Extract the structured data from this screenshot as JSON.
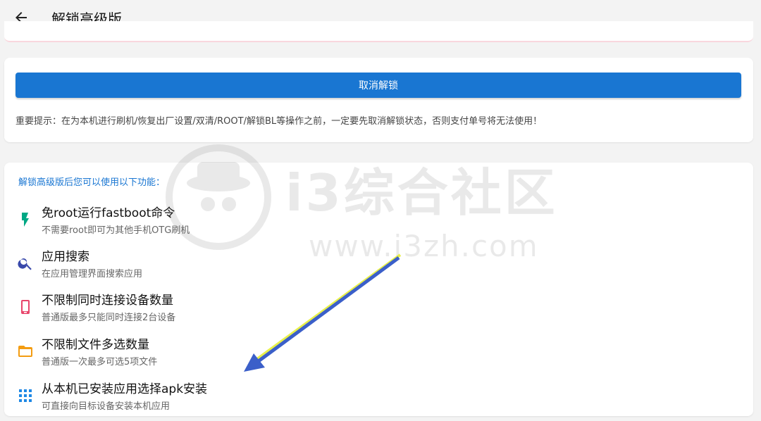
{
  "header": {
    "title": "解锁高级版",
    "back_icon": "arrow-left-icon"
  },
  "unlock_card": {
    "button_label": "取消解锁",
    "warning": "重要提示：在为本机进行刷机/恢复出厂设置/双清/ROOT/解锁BL等操作之前，一定要先取消解锁状态，否则支付单号将无法使用！"
  },
  "features": {
    "heading": "解锁高级版后您可以使用以下功能：",
    "items": [
      {
        "title": "免root运行fastboot命令",
        "subtitle": "不需要root即可为其他手机OTG刷机",
        "icon": "lightning-bolt-icon",
        "color": "#00a884"
      },
      {
        "title": "应用搜索",
        "subtitle": "在应用管理界面搜索应用",
        "icon": "search-icon",
        "color": "#3949ab"
      },
      {
        "title": "不限制同时连接设备数量",
        "subtitle": "普通版最多只能同时连接2台设备",
        "icon": "smartphone-icon",
        "color": "#e8456b"
      },
      {
        "title": "不限制文件多选数量",
        "subtitle": "普通版一次最多可选5项文件",
        "icon": "folder-icon",
        "color": "#f39c12"
      },
      {
        "title": "从本机已安装应用选择apk安装",
        "subtitle": "可直接向目标设备安装本机应用",
        "icon": "apps-grid-icon",
        "color": "#1e88e5"
      }
    ]
  },
  "watermark": {
    "text": "i3综合社区",
    "url": "www.i3zh.com"
  },
  "colors": {
    "primary": "#1976d2",
    "background": "#f3f3f3",
    "card": "#ffffff"
  }
}
